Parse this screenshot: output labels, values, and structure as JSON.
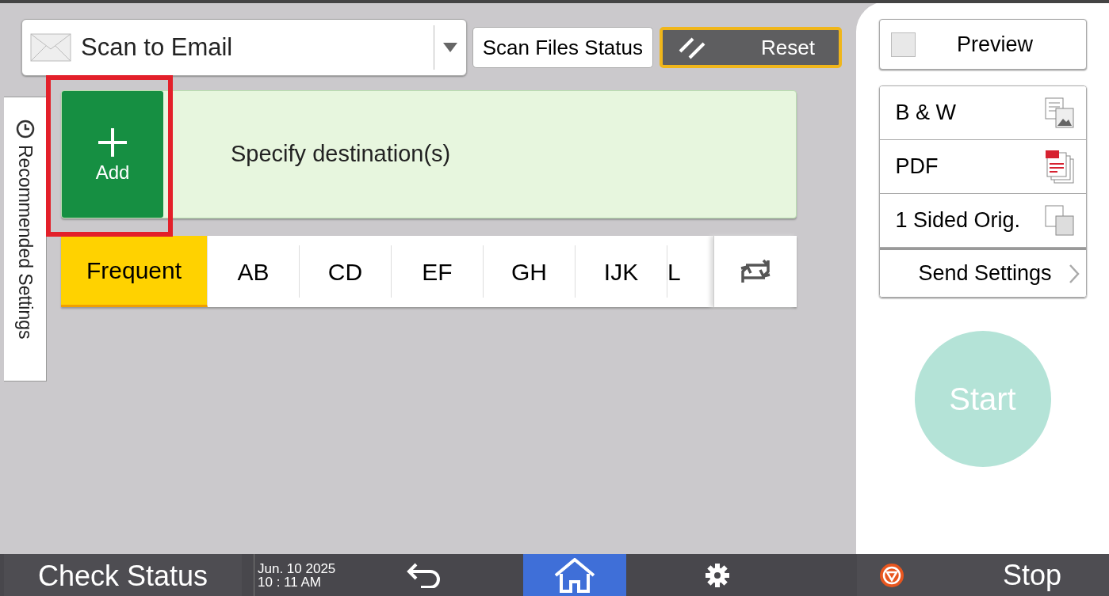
{
  "mode_selector": {
    "label": "Scan to Email"
  },
  "top_buttons": [
    {
      "kind": "plain",
      "label": "Scan Files Status"
    },
    {
      "kind": "reset",
      "label": "Reset"
    }
  ],
  "side_tab": {
    "label": "Recommended Settings"
  },
  "destination": {
    "add_label": "Add",
    "prompt": "Specify destination(s)",
    "highlighted": true
  },
  "index_tabs": [
    {
      "label": "Frequent",
      "selected": true
    },
    {
      "label": "AB",
      "selected": false
    },
    {
      "label": "CD",
      "selected": false
    },
    {
      "label": "EF",
      "selected": false
    },
    {
      "label": "GH",
      "selected": false
    },
    {
      "label": "IJK",
      "selected": false
    },
    {
      "label": "L",
      "selected": false
    }
  ],
  "preview": {
    "label": "Preview",
    "checked": false
  },
  "settings": [
    {
      "kind": "color",
      "label": "B & W"
    },
    {
      "kind": "format",
      "label": "PDF"
    },
    {
      "kind": "sides",
      "label": "1 Sided Orig."
    },
    {
      "kind": "more",
      "label": "Send Settings"
    }
  ],
  "start": {
    "label": "Start",
    "disabled": true
  },
  "status_bar": {
    "check_status": "Check Status",
    "date": "Jun. 10 2025",
    "time": "10 : 11 AM",
    "stop": "Stop",
    "nav": [
      {
        "kind": "back",
        "selected": false
      },
      {
        "kind": "home",
        "selected": true
      },
      {
        "kind": "settings",
        "selected": false
      }
    ]
  }
}
